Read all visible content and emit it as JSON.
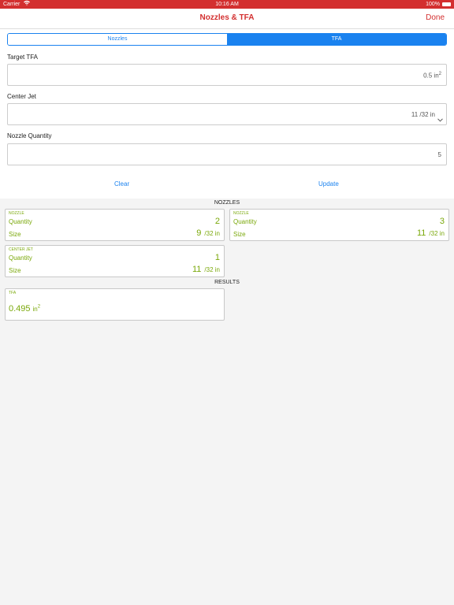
{
  "status_bar": {
    "carrier": "Carrier",
    "time": "10:16 AM",
    "battery": "100%"
  },
  "navbar": {
    "title": "Nozzles & TFA",
    "done_label": "Done"
  },
  "segmented": {
    "options": [
      "Nozzles",
      "TFA"
    ],
    "selected": "TFA"
  },
  "form": {
    "target_tfa": {
      "label": "Target TFA",
      "value": "0.5",
      "unit": "in",
      "unit_sup": "2"
    },
    "center_jet": {
      "label": "Center Jet",
      "value": "11 /32 in"
    },
    "nozzle_quantity": {
      "label": "Nozzle Quantity",
      "value": "5"
    },
    "clear_label": "Clear",
    "update_label": "Update"
  },
  "nozzles_section": {
    "title": "NOZZLES",
    "cards": [
      {
        "tag": "NOZZLE",
        "quantity_label": "Quantity",
        "quantity": "2",
        "size_label": "Size",
        "size": "9",
        "size_unit": "/32 in"
      },
      {
        "tag": "NOZZLE",
        "quantity_label": "Quantity",
        "quantity": "3",
        "size_label": "Size",
        "size": "11",
        "size_unit": "/32 in"
      },
      {
        "tag": "CENTER JET",
        "quantity_label": "Quantity",
        "quantity": "1",
        "size_label": "Size",
        "size": "11",
        "size_unit": "/32 in"
      }
    ]
  },
  "results_section": {
    "title": "RESULTS",
    "tfa": {
      "tag": "TFA",
      "value": "0.495",
      "unit": "in",
      "unit_sup": "2"
    }
  },
  "colors": {
    "accent": "#d32f2f",
    "link": "#1a82ef",
    "result_green": "#7aa80a"
  }
}
